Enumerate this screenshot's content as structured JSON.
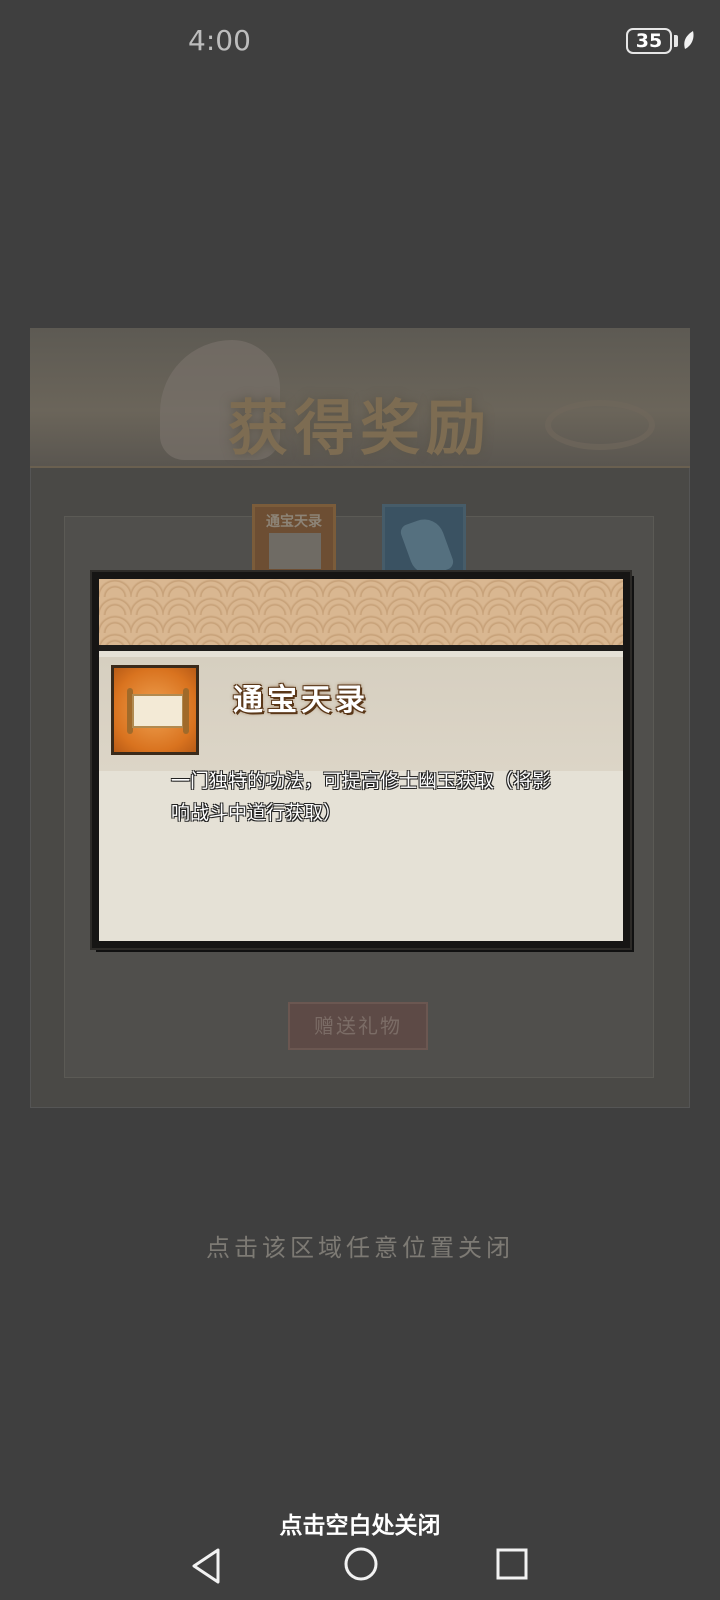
{
  "status_bar": {
    "time": "4:00",
    "battery_level": "35"
  },
  "background": {
    "reward_title": "获得奖励",
    "item_scroll_label": "通宝天录",
    "gift_button_label": "赠送礼物",
    "close_area_hint": "点击该区域任意位置关闭"
  },
  "popup": {
    "item_name": "通宝天录",
    "item_icon": "scroll-icon",
    "description": "一门独特的功法，可提高修士幽玉获取（将影响战斗中道行获取）"
  },
  "bottom": {
    "close_hint": "点击空白处关闭"
  },
  "nav": {
    "back_icon": "back-triangle-icon",
    "home_icon": "home-circle-icon",
    "recent_icon": "recent-square-icon"
  },
  "colors": {
    "overlay_bg": "#3f3f3f",
    "popup_paper": "#e5e1d6",
    "header_wave": "#d9b791",
    "item_icon_orange": "#d9731f"
  }
}
